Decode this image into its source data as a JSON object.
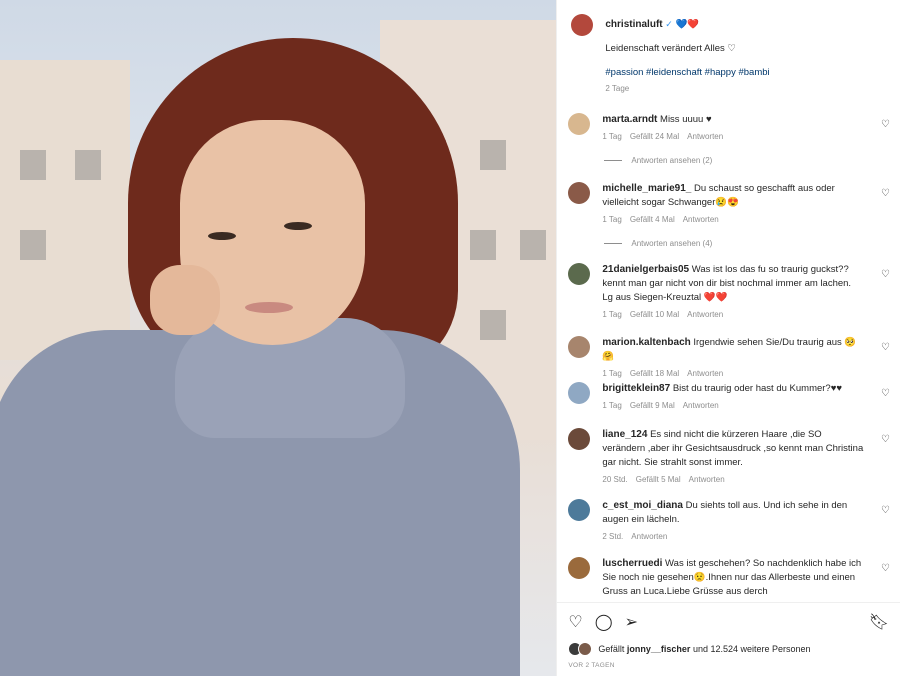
{
  "post": {
    "username": "christinaluft",
    "verified": "✓",
    "emojis": "💙❤️",
    "caption": "Leidenschaft verändert Alles ♡",
    "hashtags": "#passion #leidenschaft #happy #bambi",
    "time": "2 Tage"
  },
  "comments": [
    {
      "user": "marta.arndt",
      "text": "Miss uuuu ♥",
      "time": "1 Tag",
      "likes": "Gefällt 24 Mal",
      "reply": "Antworten",
      "view": "Antworten ansehen (2)",
      "avatar": "#d8b78f"
    },
    {
      "user": "michelle_marie91_",
      "text": "Du schaust so geschafft aus oder vielleicht sogar Schwanger😢😍",
      "time": "1 Tag",
      "likes": "Gefällt 4 Mal",
      "reply": "Antworten",
      "view": "Antworten ansehen (4)",
      "avatar": "#8a5a48"
    },
    {
      "user": "21danielgerbais05",
      "text": "Was ist los das fu so traurig guckst??kennt man gar nicht von dir bist nochmal immer am lachen. Lg aus Siegen-Kreuztal ❤️❤️",
      "time": "1 Tag",
      "likes": "Gefällt 10 Mal",
      "reply": "Antworten",
      "avatar": "#5b6a4d"
    },
    {
      "user": "marion.kaltenbach",
      "text": "Irgendwie sehen Sie/Du traurig aus 🥺🤗",
      "time": "1 Tag",
      "likes": "Gefällt 18 Mal",
      "reply": "Antworten",
      "avatar": "#a7856d"
    },
    {
      "user": "brigitteklein87",
      "text": "Bist du traurig oder hast du Kummer?♥♥",
      "time": "1 Tag",
      "likes": "Gefällt 9 Mal",
      "reply": "Antworten",
      "avatar": "#8fa8c3"
    },
    {
      "user": "liane_124",
      "text": "Es sind nicht die kürzeren Haare ,die SO verändern ,aber ihr Gesichtsausdruck ,so kennt man Christina gar nicht. Sie strahlt sonst immer.",
      "time": "20 Std.",
      "likes": "Gefällt 5 Mal",
      "reply": "Antworten",
      "avatar": "#6b4a3a"
    },
    {
      "user": "c_est_moi_diana",
      "text": "Du siehts toll aus. Und ich sehe in den augen ein lächeln.",
      "time": "2 Std.",
      "reply": "Antworten",
      "avatar": "#4d7a9a"
    },
    {
      "user": "luscherruedi",
      "text": "Was ist geschehen? So nachdenklich habe ich Sie noch nie gesehen😟.Ihnen nur das Allerbeste und einen Gruss an Luca.Liebe Grüsse aus derch",
      "avatar": "#9a6a3c"
    }
  ],
  "footer": {
    "liked_prefix": "Gefällt",
    "liked_user": "jonny__fischer",
    "liked_rest": "und 12.524 weitere Personen",
    "ago": "VOR 2 TAGEN"
  },
  "colors": {
    "link": "#00376b",
    "muted": "#8e8e8e",
    "text": "#262626",
    "hair": "#6e2a1c",
    "sweater": "#8e97ad"
  }
}
